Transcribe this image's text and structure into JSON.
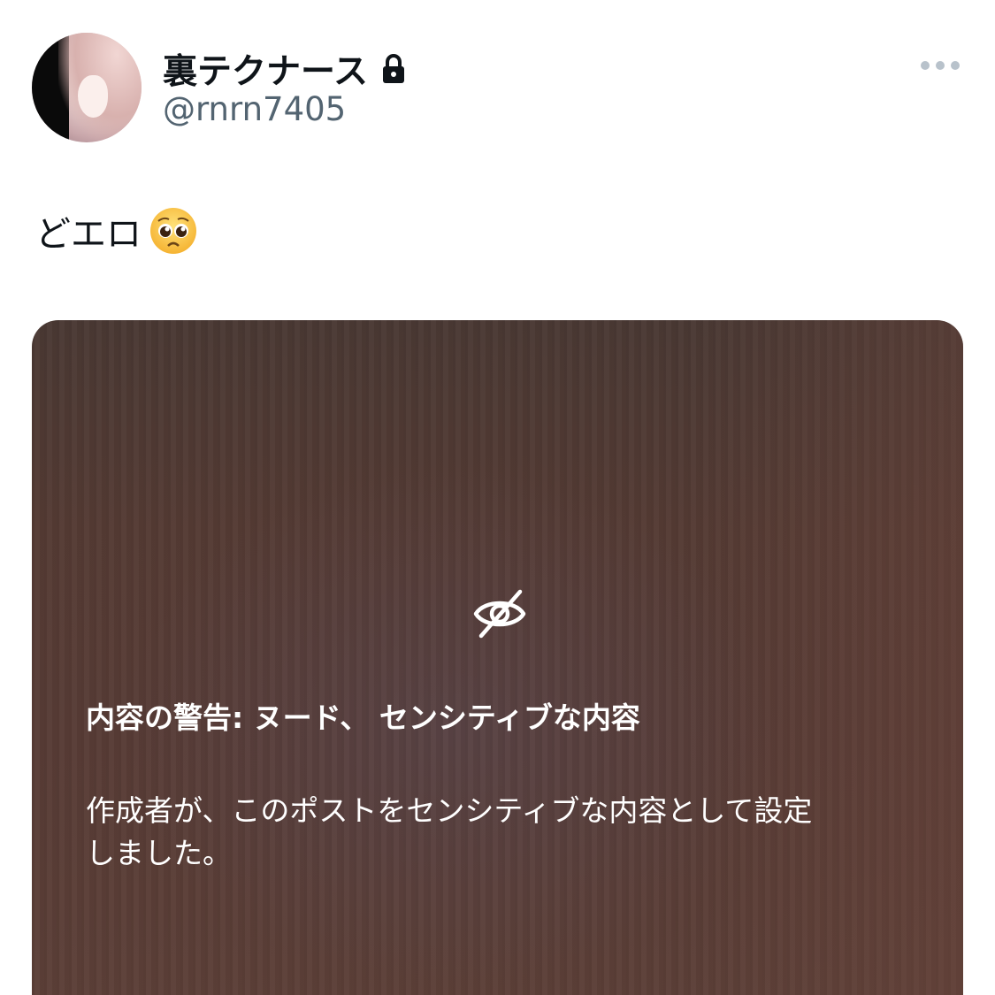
{
  "author": {
    "display_name": "裏テクナース",
    "handle": "@rnrn7405",
    "protected": true,
    "avatar": "anime-girl-avatar"
  },
  "post": {
    "text": "どエロ",
    "emoji": "pleading-face"
  },
  "menu": {
    "icon": "more-dots-icon"
  },
  "media_warning": {
    "icon": "eye-off-icon",
    "title": "内容の警告: ヌード、 センシティブな内容",
    "description_line1": "作成者が、このポストをセンシティブな内容として設定",
    "description_line2": "しました。"
  },
  "colors": {
    "name_text": "#0f1419",
    "handle_text": "#536471",
    "dots": "#b8c2cb",
    "media_bg": "#553b34"
  }
}
